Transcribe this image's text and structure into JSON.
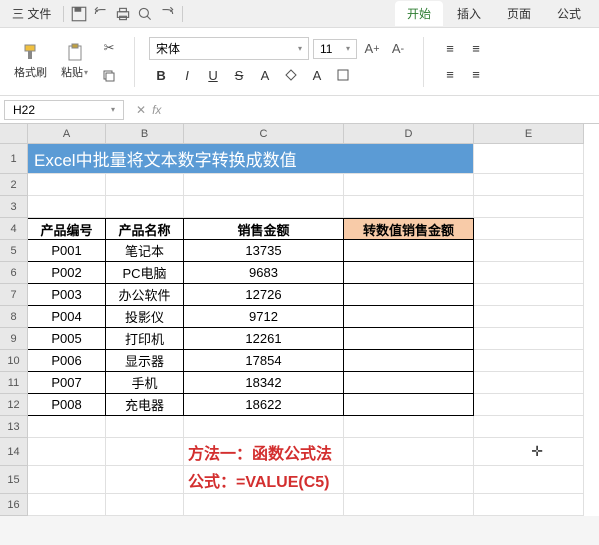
{
  "menubar": {
    "file": "三 文件",
    "tabs": [
      "开始",
      "插入",
      "页面",
      "公式"
    ],
    "active_tab": 0
  },
  "ribbon": {
    "format_painter": "格式刷",
    "paste": "粘贴",
    "font_name": "宋体",
    "font_size": "11",
    "bold": "B",
    "italic": "I",
    "underline": "U",
    "strike": "S"
  },
  "formula_bar": {
    "name": "H22",
    "fx": "fx",
    "value": ""
  },
  "columns": [
    "A",
    "B",
    "C",
    "D",
    "E"
  ],
  "title": "Excel中批量将文本数字转换成数值",
  "headers": {
    "id": "产品编号",
    "name": "产品名称",
    "amount": "销售金额",
    "converted": "转数值销售金额"
  },
  "rows": [
    {
      "id": "P001",
      "name": "笔记本",
      "amount": "13735"
    },
    {
      "id": "P002",
      "name": "PC电脑",
      "amount": "9683"
    },
    {
      "id": "P003",
      "name": "办公软件",
      "amount": "12726"
    },
    {
      "id": "P004",
      "name": "投影仪",
      "amount": "9712"
    },
    {
      "id": "P005",
      "name": "打印机",
      "amount": "12261"
    },
    {
      "id": "P006",
      "name": "显示器",
      "amount": "17854"
    },
    {
      "id": "P007",
      "name": "手机",
      "amount": "18342"
    },
    {
      "id": "P008",
      "name": "充电器",
      "amount": "18622"
    }
  ],
  "method": {
    "line1": "方法一：函数公式法",
    "line2": "公式：=VALUE(C5)"
  },
  "row_numbers": [
    "1",
    "2",
    "3",
    "4",
    "5",
    "6",
    "7",
    "8",
    "9",
    "10",
    "11",
    "12",
    "13",
    "14",
    "15",
    "16"
  ]
}
